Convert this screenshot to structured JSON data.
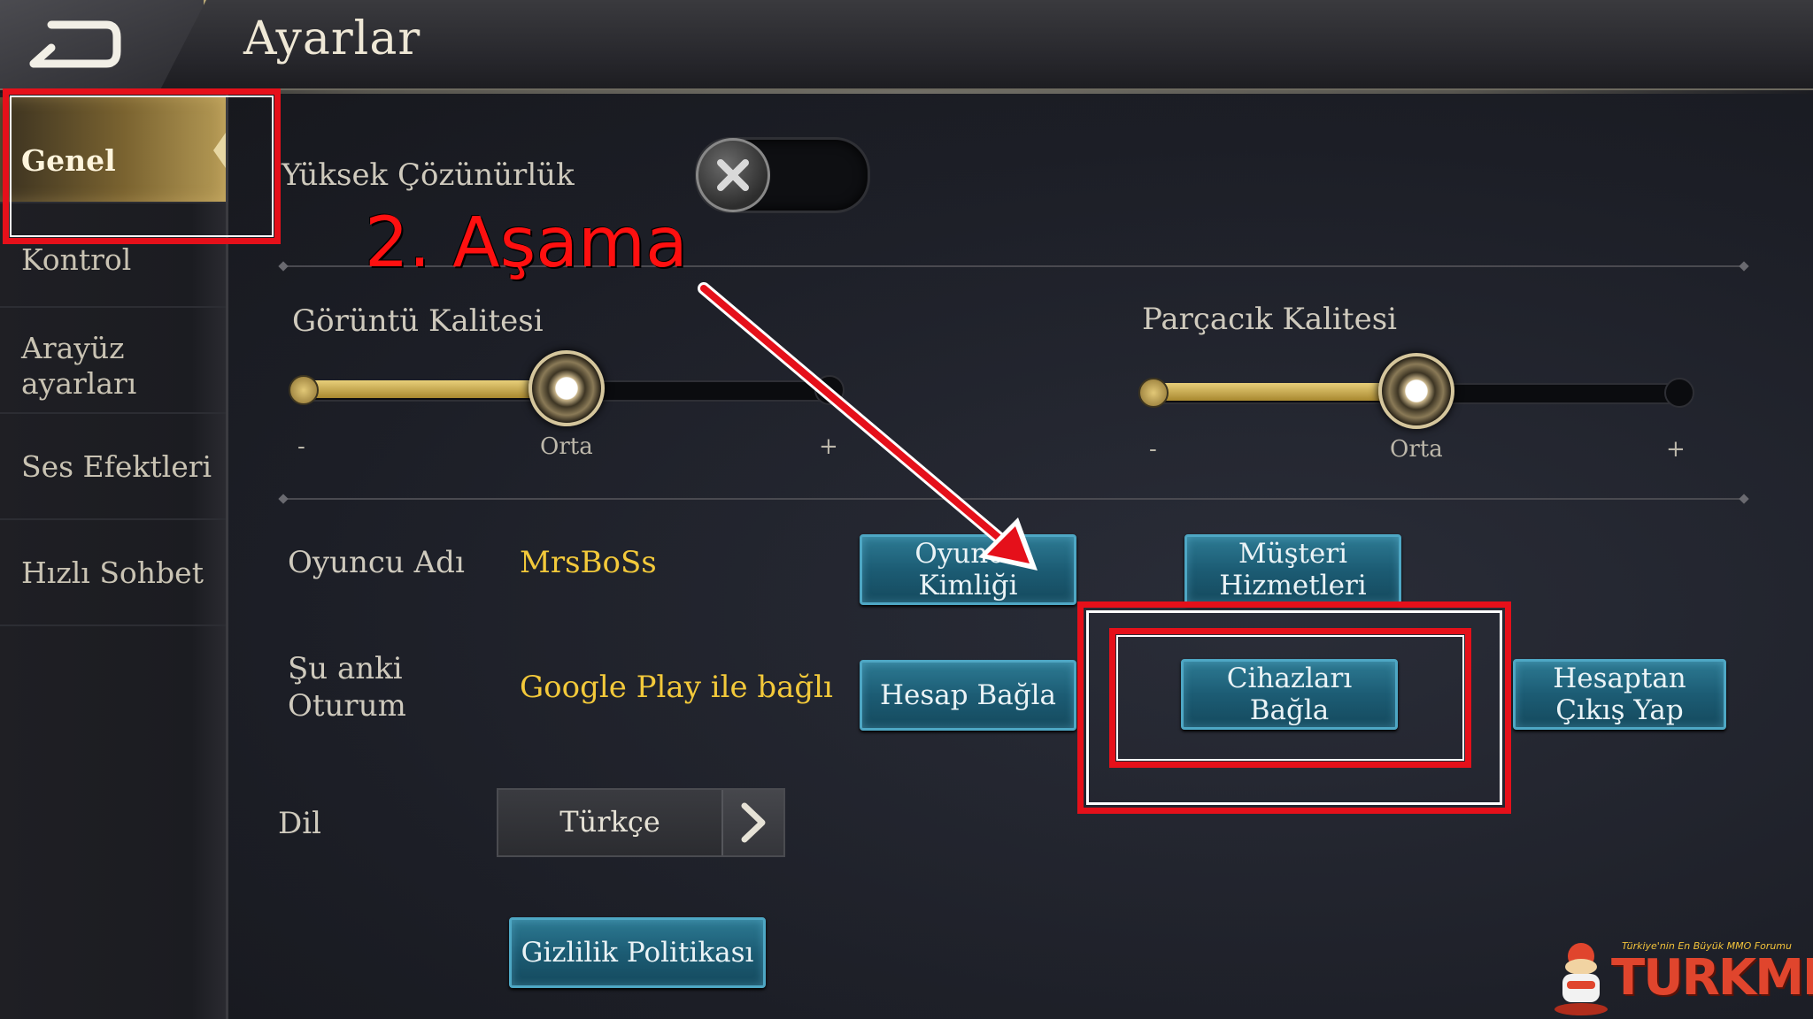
{
  "header": {
    "title": "Ayarlar"
  },
  "sidebar": {
    "items": [
      {
        "label": "Genel"
      },
      {
        "label": "Kontrol"
      },
      {
        "label": "Arayüz ayarları"
      },
      {
        "label": "Ses Efektleri"
      },
      {
        "label": "Hızlı Sohbet"
      }
    ],
    "active_index": 0
  },
  "settings": {
    "high_resolution": {
      "label": "Yüksek Çözünürlük",
      "enabled": false
    },
    "image_quality": {
      "label": "Görüntü Kalitesi",
      "minus": "-",
      "value_label": "Orta",
      "plus": "+",
      "level": 0.5
    },
    "particle_quality": {
      "label": "Parçacık Kalitesi",
      "minus": "-",
      "value_label": "Orta",
      "plus": "+",
      "level": 0.5
    },
    "player_name": {
      "label": "Oyuncu Adı",
      "value": "MrsBoSs"
    },
    "current_session": {
      "label": "Şu anki Oturum",
      "value": "Google Play ile bağlı"
    },
    "language": {
      "label": "Dil",
      "value": "Türkçe"
    }
  },
  "buttons": {
    "player_id": "Oyuncu Kimliği",
    "customer_service": "Müşteri Hizmetleri",
    "link_account": "Hesap Bağla",
    "link_devices": "Cihazları Bağla",
    "logout": "Hesaptan Çıkış Yap",
    "privacy_policy": "Gizlilik Politikası"
  },
  "annotation": {
    "text": "2. Aşama",
    "color": "#e5101a"
  },
  "watermark": {
    "tagline": "Türkiye'nin En Büyük MMO Forumu",
    "brand": "TURKMMO"
  },
  "colors": {
    "accent_gold": "#f3c93a",
    "button_teal": "#1c5c74",
    "highlight_red": "#e5101a"
  }
}
